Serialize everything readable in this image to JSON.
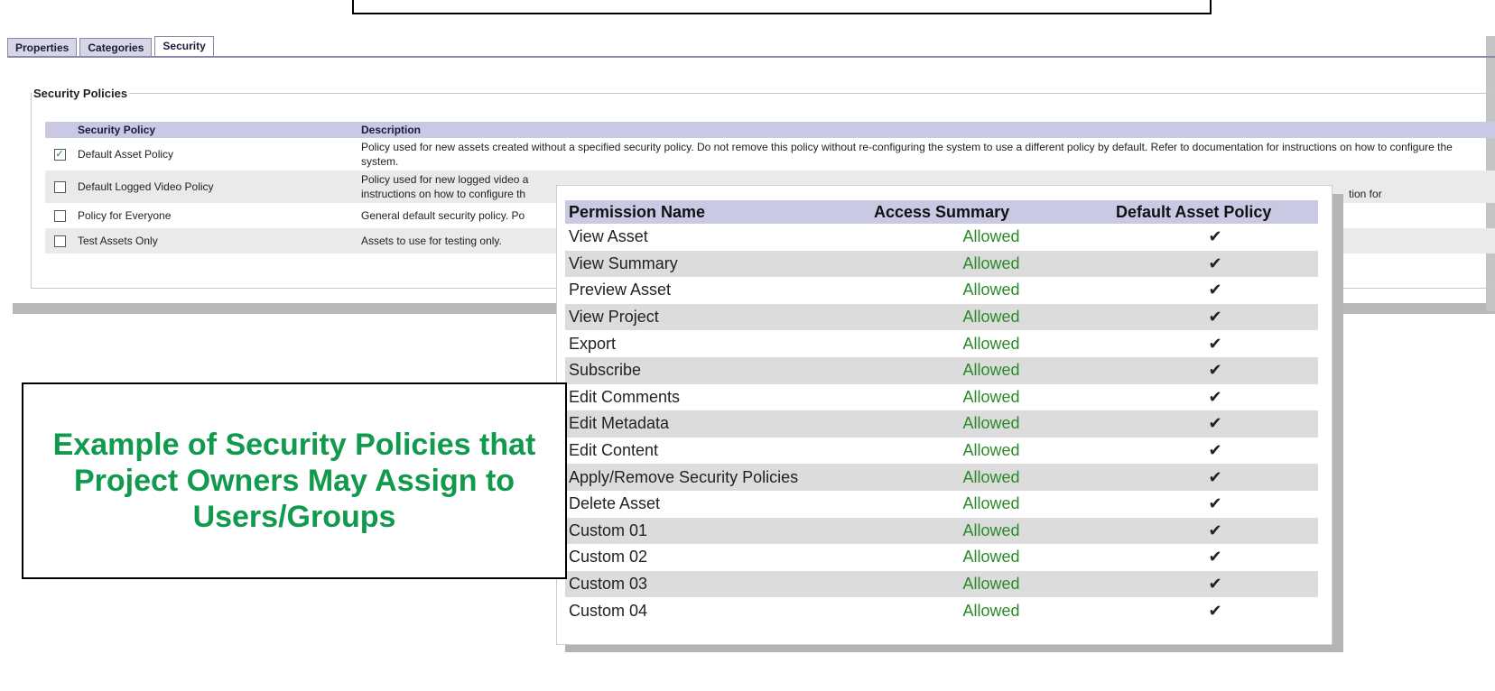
{
  "tabs": [
    "Properties",
    "Categories",
    "Security"
  ],
  "active_tab": "Security",
  "security_policies": {
    "legend": "Security Policies",
    "headers": {
      "policy": "Security Policy",
      "description": "Description"
    },
    "rows": [
      {
        "checked": true,
        "name": "Default Asset Policy",
        "description": "Policy used for new assets created without a specified security policy. Do not remove this policy without re-configuring the system to use a different policy by default. Refer to documentation for instructions on how to configure the system."
      },
      {
        "checked": false,
        "name": "Default Logged Video Policy",
        "description": "Policy used for new logged video a",
        "description_cont": "instructions on how to configure th",
        "description_tail": "tion for"
      },
      {
        "checked": false,
        "name": "Policy for Everyone",
        "description": "General default security policy. Po"
      },
      {
        "checked": false,
        "name": "Test Assets Only",
        "description": "Assets to use for testing only."
      }
    ]
  },
  "permissions": {
    "headers": {
      "name": "Permission Name",
      "access": "Access Summary",
      "policy": "Default Asset Policy"
    },
    "check_glyph": "✔",
    "rows": [
      {
        "name": "View Asset",
        "access": "Allowed"
      },
      {
        "name": "View Summary",
        "access": "Allowed"
      },
      {
        "name": "Preview Asset",
        "access": "Allowed"
      },
      {
        "name": "View Project",
        "access": "Allowed"
      },
      {
        "name": "Export",
        "access": "Allowed"
      },
      {
        "name": "Subscribe",
        "access": "Allowed"
      },
      {
        "name": "Edit Comments",
        "access": "Allowed"
      },
      {
        "name": "Edit Metadata",
        "access": "Allowed"
      },
      {
        "name": "Edit Content",
        "access": "Allowed"
      },
      {
        "name": "Apply/Remove Security Policies",
        "access": "Allowed"
      },
      {
        "name": "Delete Asset",
        "access": "Allowed"
      },
      {
        "name": "Custom 01",
        "access": "Allowed"
      },
      {
        "name": "Custom 02",
        "access": "Allowed"
      },
      {
        "name": "Custom 03",
        "access": "Allowed"
      },
      {
        "name": "Custom 04",
        "access": "Allowed"
      }
    ]
  },
  "callout": {
    "text": "Example of Security Policies that Project Owners May Assign to Users/Groups"
  },
  "colors": {
    "accent_green": "#119a4e",
    "allowed_green": "#2a8a2a",
    "header_lavender": "#c9c9e4"
  }
}
